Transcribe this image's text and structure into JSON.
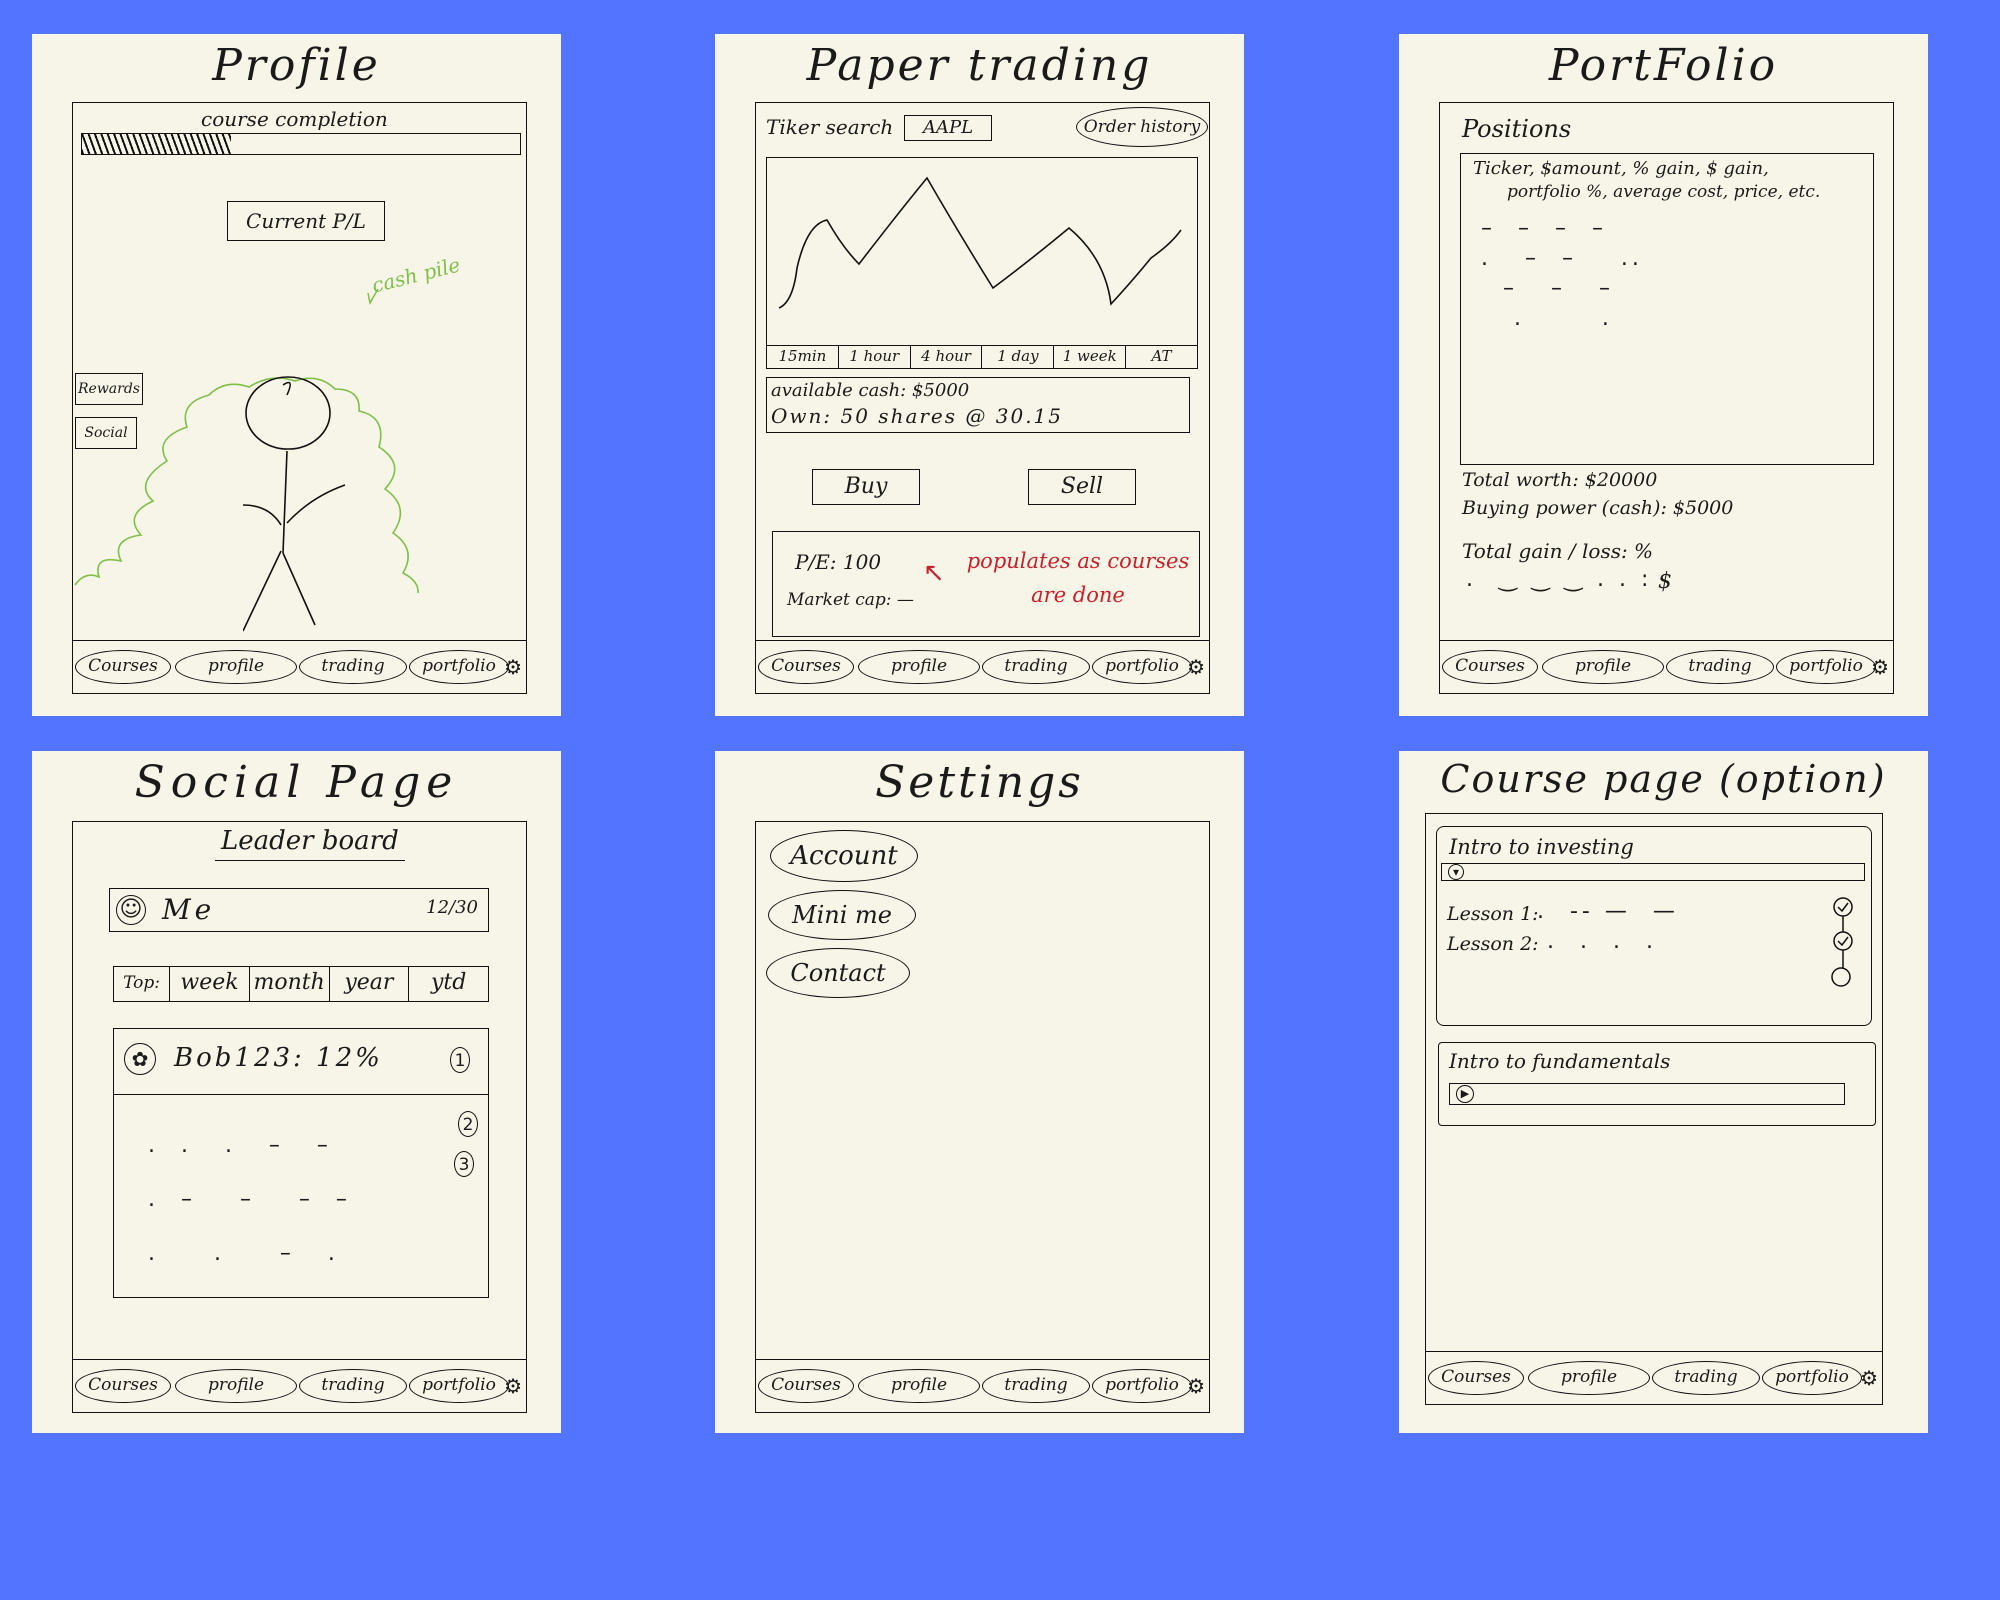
{
  "nav": {
    "courses": "Courses",
    "profile": "profile",
    "trading": "trading",
    "portfolio": "portfolio",
    "settings_icon": "gear-icon"
  },
  "profile": {
    "title": "Profile",
    "course_completion": "course completion",
    "course_completion_progress": 0.34,
    "current_pl": "Current P/L",
    "cash_pile": "cash pile",
    "rewards": "Rewards",
    "social": "Social"
  },
  "trading": {
    "title": "Paper trading",
    "ticker_label": "Tiker search",
    "ticker_value": "AAPL",
    "order_history": "Order history",
    "timeframes": [
      "15min",
      "1 hour",
      "4 hour",
      "1 day",
      "1 week",
      "AT"
    ],
    "available_cash": "available cash: $5000",
    "own": "Own: 50 shares @ 30.15",
    "buy": "Buy",
    "sell": "Sell",
    "pe": "P/E: 100",
    "market_cap": "Market cap: —",
    "note": "populates as courses are done"
  },
  "portfolio": {
    "title": "PortFolio",
    "positions": "Positions",
    "columns_line1": "Ticker, $amount, % gain, $ gain,",
    "columns_line2": "portfolio %, average cost, price, etc.",
    "total_worth": "Total worth: $20000",
    "buying_power": "Buying power (cash): $5000",
    "total_gain": "Total gain / loss: %",
    "total_gain_dollar": "$"
  },
  "social": {
    "title": "Social Page",
    "leaderboard": "Leader board",
    "me_label": "Me",
    "me_score": "12/30",
    "top_label": "Top:",
    "periods": [
      "week",
      "month",
      "year",
      "ytd"
    ],
    "first_entry": "Bob123: 12%",
    "ranks": [
      "1",
      "2",
      "3"
    ]
  },
  "settings": {
    "title": "Settings",
    "items": [
      "Account",
      "Mini me",
      "Contact"
    ]
  },
  "course": {
    "title": "Course page (option)",
    "course1": "Intro to investing",
    "lesson1": "Lesson 1:",
    "lesson2": "Lesson 2:",
    "course2": "Intro to fundamentals"
  }
}
